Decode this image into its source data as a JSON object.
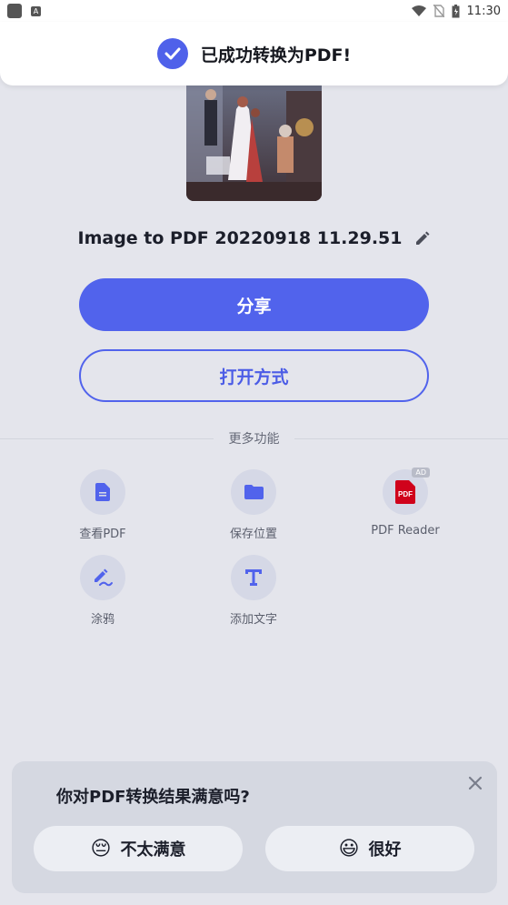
{
  "status_bar": {
    "time": "11:30"
  },
  "toast": {
    "message": "已成功转换为PDF!"
  },
  "file": {
    "name": "Image to PDF 20220918 11.29.51"
  },
  "actions": {
    "share_label": "分享",
    "open_with_label": "打开方式"
  },
  "more_features": {
    "title": "更多功能",
    "items": [
      {
        "label": "查看PDF",
        "icon": "document-icon"
      },
      {
        "label": "保存位置",
        "icon": "folder-icon"
      },
      {
        "label": "PDF Reader",
        "icon": "pdf-app-icon",
        "badge": "AD"
      },
      {
        "label": "涂鸦",
        "icon": "draw-icon"
      },
      {
        "label": "添加文字",
        "icon": "text-icon"
      }
    ]
  },
  "feedback": {
    "question": "你对PDF转换结果满意吗?",
    "negative_label": "不太满意",
    "negative_emoji": "😔",
    "positive_label": "很好",
    "positive_emoji": "😃"
  },
  "colors": {
    "accent": "#5163ec",
    "background": "#e4e5ec",
    "pdf_red": "#d0021b"
  }
}
